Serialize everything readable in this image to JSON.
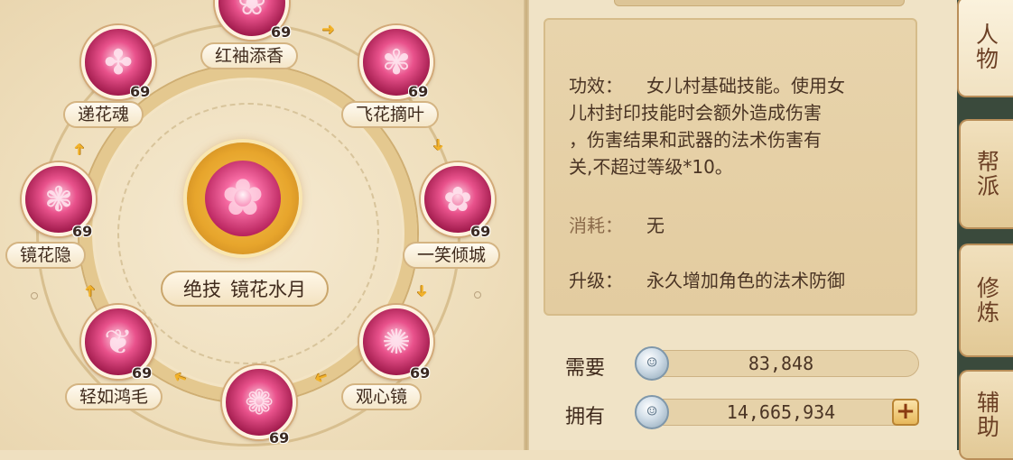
{
  "skill_wheel": {
    "center": {
      "prefix": "绝技",
      "name": "镜花水月"
    },
    "skills": [
      {
        "name": "红袖添香",
        "level": "69",
        "icon": "sleeve-flower-icon"
      },
      {
        "name": "飞花摘叶",
        "level": "69",
        "icon": "flying-petals-icon"
      },
      {
        "name": "一笑倾城",
        "level": "69",
        "icon": "dancer-icon"
      },
      {
        "name": "观心镜",
        "level": "69",
        "icon": "mirror-icon"
      },
      {
        "name": "",
        "level": "69",
        "icon": "lotus-bloom-icon"
      },
      {
        "name": "轻如鸿毛",
        "level": "69",
        "icon": "crane-icon"
      },
      {
        "name": "镜花隐",
        "level": "69",
        "icon": "lotus-icon"
      },
      {
        "name": "递花魂",
        "level": "69",
        "icon": "flower-soul-icon"
      }
    ]
  },
  "details": {
    "effect_label": "功效：",
    "effect_lines": [
      "女儿村基础技能。使用女",
      "儿村封印技能时会额外造成伤害",
      "，伤害结果和武器的法术伤害有",
      "关,不超过等级*10。"
    ],
    "cost_label": "消耗：",
    "cost_value": "无",
    "upgrade_label": "升级：",
    "upgrade_value": "永久增加角色的法术防御"
  },
  "resources": {
    "need_label": "需要",
    "need_value": "83,848",
    "have_label": "拥有",
    "have_value": "14,665,934",
    "add_label": "+"
  },
  "tabs": [
    "人物",
    "帮派",
    "修炼",
    "辅助"
  ],
  "colors": {
    "accent_gold": "#e7a52c",
    "skill_pink": "#e9528c",
    "tab_text": "#6b3f24"
  }
}
